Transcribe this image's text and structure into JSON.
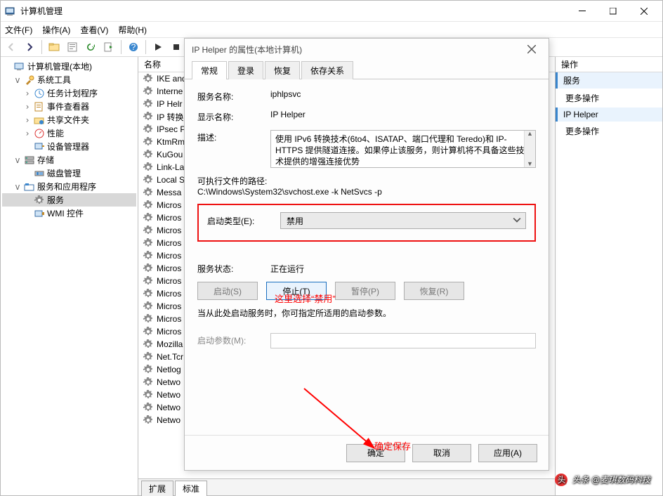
{
  "window": {
    "title": "计算机管理"
  },
  "menu": {
    "file": "文件(F)",
    "action": "操作(A)",
    "view": "查看(V)",
    "help": "帮助(H)"
  },
  "tree": {
    "root": "计算机管理(本地)",
    "system_tools": "系统工具",
    "task_scheduler": "任务计划程序",
    "event_viewer": "事件查看器",
    "shared_folders": "共享文件夹",
    "performance": "性能",
    "device_manager": "设备管理器",
    "storage": "存储",
    "disk_mgmt": "磁盘管理",
    "svc_apps": "服务和应用程序",
    "services": "服务",
    "wmi": "WMI 控件"
  },
  "list": {
    "header": "名称",
    "items": [
      "IKE and",
      "Interne",
      "IP Helr",
      "IP 转换",
      "IPsec P",
      "KtmRm",
      "KuGou",
      "Link-La",
      "Local S",
      "Messa",
      "Micros",
      "Micros",
      "Micros",
      "Micros",
      "Micros",
      "Micros",
      "Micros",
      "Micros",
      "Micros",
      "Micros",
      "Micros",
      "Mozilla",
      "Net.Tcr",
      "Netlog",
      "Netwo",
      "Netwo",
      "Netwo",
      "Netwo"
    ],
    "tabs": {
      "ext": "扩展",
      "std": "标准"
    }
  },
  "actions_pane": {
    "header": "操作",
    "section_services": "服务",
    "more1": "更多操作",
    "section_iphelper": "IP Helper",
    "more2": "更多操作"
  },
  "dialog": {
    "title": "IP Helper 的属性(本地计算机)",
    "tabs": {
      "general": "常规",
      "logon": "登录",
      "recovery": "恢复",
      "deps": "依存关系"
    },
    "labels": {
      "svc_name": "服务名称:",
      "display_name": "显示名称:",
      "description": "描述:",
      "exe_path": "可执行文件的路径:",
      "startup_type": "启动类型(E):",
      "status": "服务状态:",
      "start_params": "启动参数(M):"
    },
    "values": {
      "svc_name": "iphlpsvc",
      "display_name": "IP Helper",
      "description": "使用 IPv6 转换技术(6to4、ISATAP、端口代理和 Teredo)和 IP-HTTPS 提供隧道连接。如果停止该服务，则计算机将不具备这些技术提供的增强连接优势",
      "exe_path": "C:\\Windows\\System32\\svchost.exe -k NetSvcs -p",
      "startup_type": "禁用",
      "status": "正在运行"
    },
    "buttons": {
      "start": "启动(S)",
      "stop": "停止(T)",
      "pause": "暂停(P)",
      "resume": "恢复(R)"
    },
    "note": "当从此处启动服务时，你可指定所适用的启动参数。",
    "footer": {
      "ok": "确定",
      "cancel": "取消",
      "apply": "应用(A)"
    },
    "annot_startup": "这里选择“禁用”",
    "annot_ok": "确定保存"
  },
  "watermark": "头条 @麦琪数码科技"
}
